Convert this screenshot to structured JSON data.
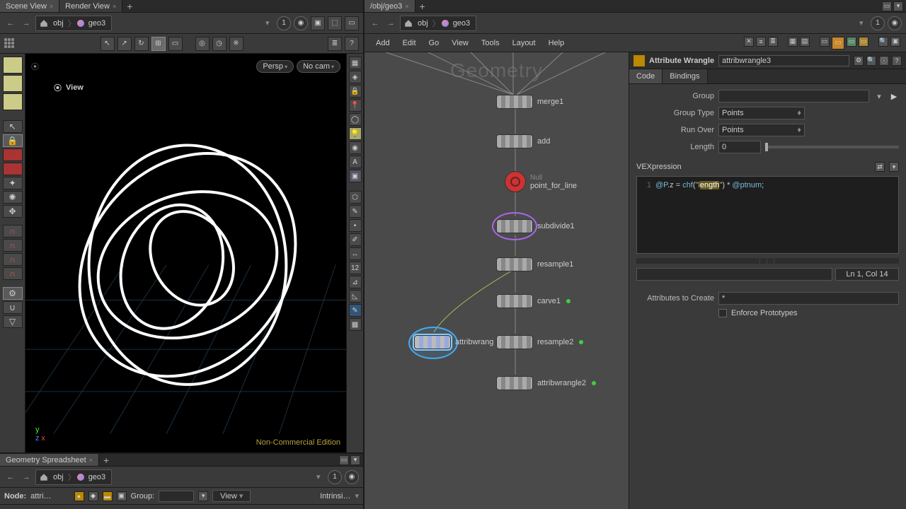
{
  "left": {
    "tabs": [
      "Scene View",
      "Render View"
    ],
    "path": {
      "level": "obj",
      "node": "geo3",
      "pin": "1"
    },
    "view_label": "View",
    "persp": "Persp",
    "cam": "No cam",
    "watermark": "Non-Commercial Edition"
  },
  "geo_ss": {
    "tab": "Geometry Spreadsheet",
    "path": {
      "level": "obj",
      "node": "geo3",
      "pin": "1"
    },
    "node_label": "Node:",
    "node_value": "attri…",
    "group_label": "Group:",
    "view_dd": "View",
    "intrinsic": "Intrinsi…"
  },
  "right": {
    "tab_path": "/obj/geo3",
    "path": {
      "level": "obj",
      "node": "geo3",
      "pin": "1"
    },
    "menu": [
      "Add",
      "Edit",
      "Go",
      "View",
      "Tools",
      "Layout",
      "Help"
    ],
    "net_overlay": "Geometry",
    "nodes": {
      "merge1": "merge1",
      "add": "add",
      "null_type": "Null",
      "point_for_line": "point_for_line",
      "subdivide1": "subdivide1",
      "resample1": "resample1",
      "carve1": "carve1",
      "attribwrangle_sel": "attribwrang",
      "resample2": "resample2",
      "attribwrangle2": "attribwrangle2"
    }
  },
  "params": {
    "op_type": "Attribute Wrangle",
    "op_name": "attribwrangle3",
    "tabs": [
      "Code",
      "Bindings"
    ],
    "group_label": "Group",
    "grouptype_label": "Group Type",
    "grouptype_value": "Points",
    "runover_label": "Run Over",
    "runover_value": "Points",
    "length_label": "Length",
    "length_value": "0",
    "vex_label": "VEXpression",
    "code_line": "1",
    "code_pre": "@P.z = chf(",
    "code_q1": "\"l",
    "code_hilite": "ength",
    "code_q2": "\"",
    "code_post": ") * @ptnum;",
    "cursor": "Ln 1, Col 14",
    "attrs_label": "Attributes to Create",
    "attrs_value": "*",
    "enforce_label": "Enforce Prototypes"
  }
}
